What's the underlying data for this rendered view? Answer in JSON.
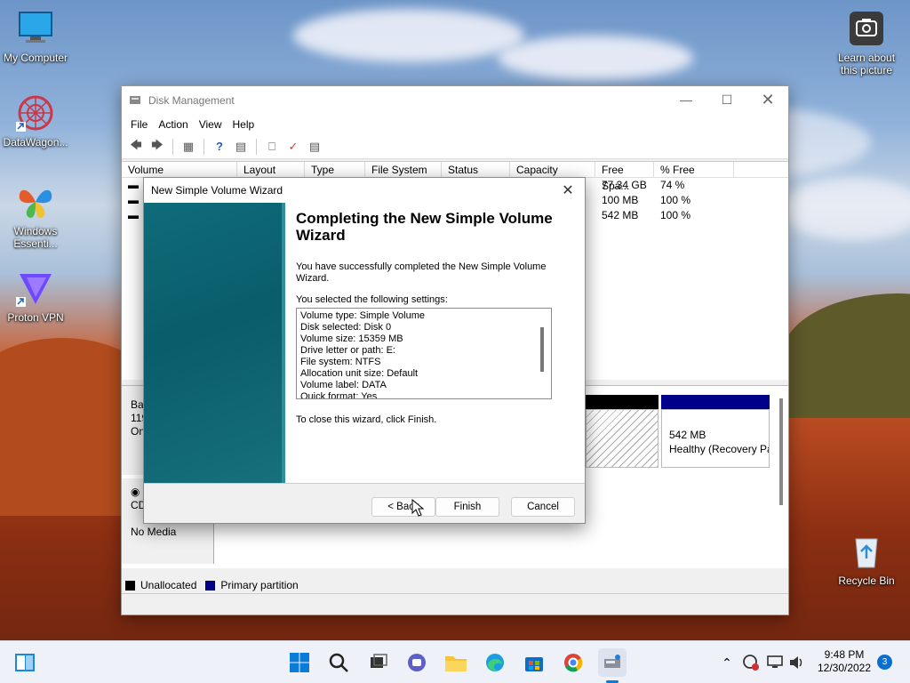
{
  "desktop": {
    "icons": [
      {
        "label": "My Computer"
      },
      {
        "label": "DataWagon..."
      },
      {
        "label": "Windows Essenti..."
      },
      {
        "label": "Proton VPN"
      },
      {
        "label": "Learn about this picture"
      },
      {
        "label": "Recycle Bin"
      }
    ]
  },
  "window": {
    "title": "Disk Management",
    "menu": [
      "File",
      "Action",
      "View",
      "Help"
    ],
    "columns": [
      "Volume",
      "Layout",
      "Type",
      "File System",
      "Status",
      "Capacity",
      "Free Spa...",
      "% Free"
    ],
    "rows": [
      {
        "free": "77.34 GB",
        "pct": "74 %"
      },
      {
        "free": "100 MB",
        "pct": "100 %"
      },
      {
        "free": "542 MB",
        "pct": "100 %"
      }
    ],
    "disk0": {
      "line1": "Bas",
      "line2": "119",
      "line3": "On"
    },
    "partition": {
      "size": "542 MB",
      "status": "Healthy (Recovery Pa"
    },
    "cdrom": {
      "label": "CD",
      "media": "No Media"
    },
    "legend": {
      "unallocated": "Unallocated",
      "primary": "Primary partition"
    },
    "colors": {
      "unallocated": "#000000",
      "primary": "#00008b"
    }
  },
  "wizard": {
    "title": "New Simple Volume Wizard",
    "heading": "Completing the New Simple Volume Wizard",
    "success": "You have successfully completed the New Simple Volume Wizard.",
    "settings_label": "You selected the following settings:",
    "settings": [
      "Volume type: Simple Volume",
      "Disk selected: Disk 0",
      "Volume size: 15359 MB",
      "Drive letter or path: E:",
      "File system: NTFS",
      "Allocation unit size: Default",
      "Volume label: DATA",
      "Quick format: Yes"
    ],
    "close_hint": "To close this wizard, click Finish.",
    "buttons": {
      "back": "< Back",
      "finish": "Finish",
      "cancel": "Cancel"
    }
  },
  "taskbar": {
    "time": "9:48 PM",
    "date": "12/30/2022",
    "notifications": "3"
  }
}
